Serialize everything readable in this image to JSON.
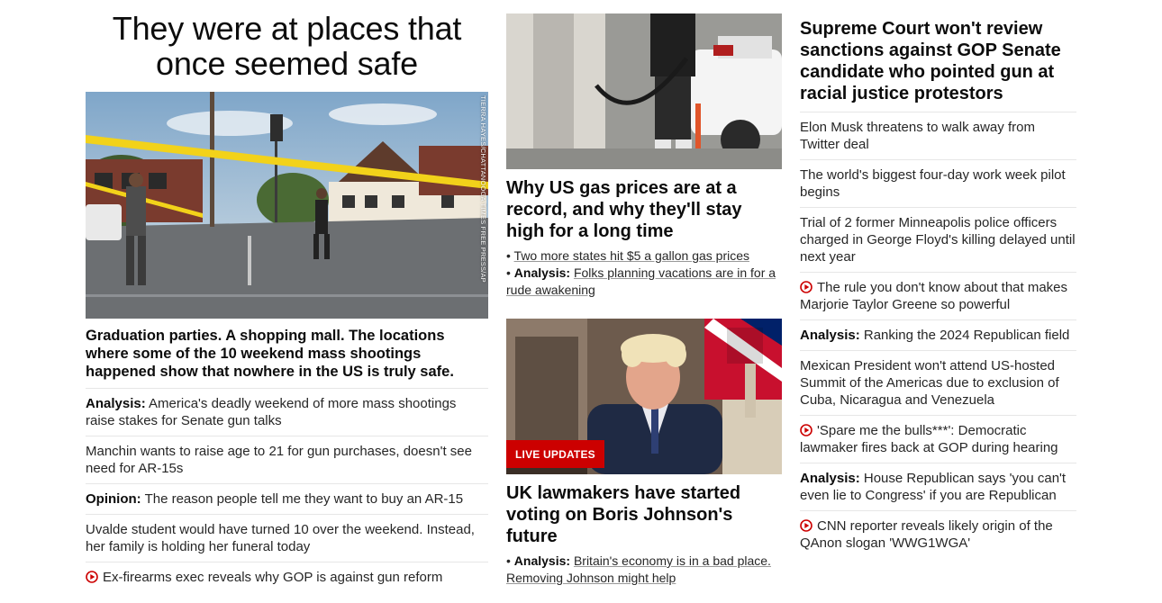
{
  "left": {
    "headline": "They were at places that once seemed safe",
    "image_credit": "TIERRA HAYES/CHATTANOOGA TIMES FREE PRESS/AP",
    "caption": "Graduation parties. A shopping mall. The locations where some of the 10 weekend mass shootings happened show that nowhere in the US is truly safe.",
    "items": [
      {
        "prefix": "Analysis:",
        "text": "America's deadly weekend of more mass shootings raise stakes for Senate gun talks",
        "video": false
      },
      {
        "prefix": "",
        "text": "Manchin wants to raise age to 21 for gun purchases, doesn't see need for AR-15s",
        "video": false
      },
      {
        "prefix": "Opinion:",
        "text": "The reason people tell me they want to buy an AR-15",
        "video": false
      },
      {
        "prefix": "",
        "text": "Uvalde student would have turned 10 over the weekend. Instead, her family is holding her funeral today",
        "video": false
      },
      {
        "prefix": "",
        "text": "Ex-firearms exec reveals why GOP is against gun reform",
        "video": true
      }
    ]
  },
  "middle": {
    "story1": {
      "headline": "Why US gas prices are at a record, and why they'll stay high for a long time",
      "sub": [
        {
          "bullet": "•",
          "prefix": "",
          "text": "Two more states hit $5 a gallon gas prices"
        },
        {
          "bullet": "•",
          "prefix": "Analysis:",
          "text": "Folks planning vacations are in for a rude awakening"
        }
      ]
    },
    "story2": {
      "badge": "LIVE UPDATES",
      "headline": "UK lawmakers have started voting on Boris Johnson's future",
      "sub": [
        {
          "bullet": "•",
          "prefix": "Analysis:",
          "text": "Britain's economy is in a bad place. Removing Johnson might help"
        }
      ]
    }
  },
  "right": {
    "headline": "Supreme Court won't review sanctions against GOP Senate candidate who pointed gun at racial justice protestors",
    "items": [
      {
        "prefix": "",
        "text": "Elon Musk threatens to walk away from Twitter deal",
        "video": false
      },
      {
        "prefix": "",
        "text": "The world's biggest four-day work week pilot begins",
        "video": false
      },
      {
        "prefix": "",
        "text": "Trial of 2 former Minneapolis police officers charged in George Floyd's killing delayed until next year",
        "video": false
      },
      {
        "prefix": "",
        "text": "The rule you don't know about that makes Marjorie Taylor Greene so powerful",
        "video": true
      },
      {
        "prefix": "Analysis:",
        "text": "Ranking the 2024 Republican field",
        "video": false
      },
      {
        "prefix": "",
        "text": "Mexican President won't attend US-hosted Summit of the Americas due to exclusion of Cuba, Nicaragua and Venezuela",
        "video": false
      },
      {
        "prefix": "",
        "text": "'Spare me the bulls***': Democratic lawmaker fires back at GOP during hearing",
        "video": true
      },
      {
        "prefix": "Analysis:",
        "text": "House Republican says 'you can't even lie to Congress' if you are Republican",
        "video": false
      },
      {
        "prefix": "",
        "text": "CNN reporter reveals likely origin of the QAnon slogan 'WWG1WGA'",
        "video": true
      }
    ]
  },
  "colors": {
    "accent_red": "#cc0000",
    "divider": "#e6e6e6",
    "text": "#0c0c0c"
  },
  "icons": {
    "video": "play-circle-icon"
  }
}
